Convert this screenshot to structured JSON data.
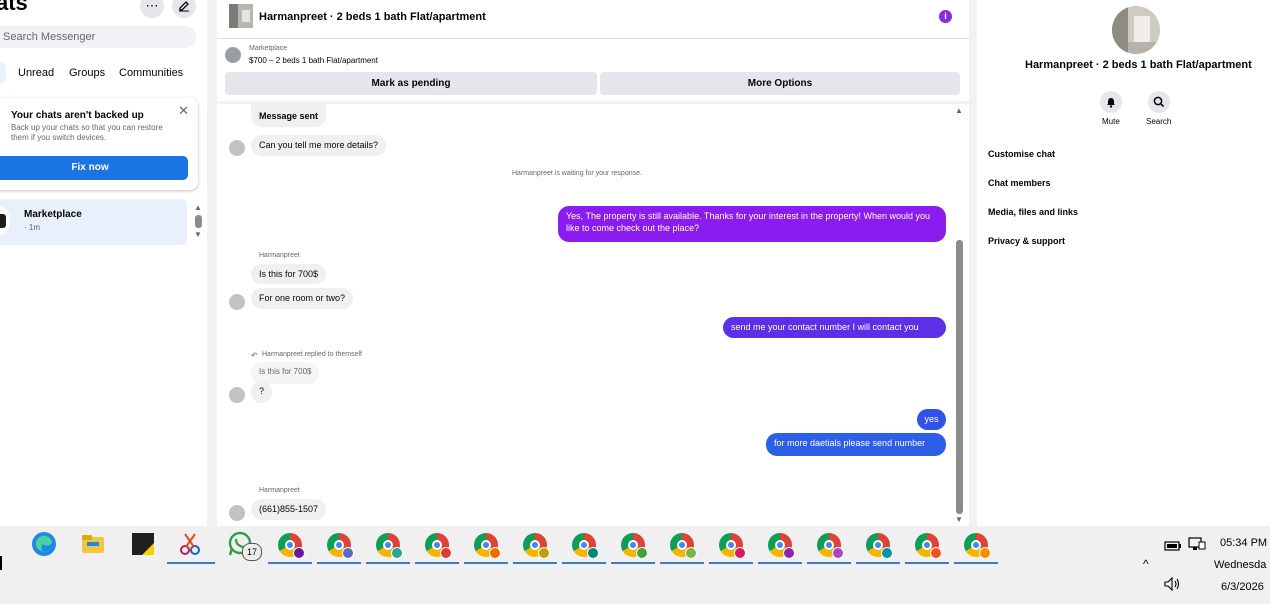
{
  "sidebar": {
    "title": "ats",
    "more_icon": "more-dots-icon",
    "compose_icon": "compose-icon",
    "search_placeholder": "Search Messenger",
    "filters": [
      "Unread",
      "Groups",
      "Communities"
    ],
    "backup_banner": {
      "title": "Your chats aren't backed up",
      "subtitle": "Back up your chats so that you can restore them if you switch devices.",
      "button": "Fix now"
    },
    "chat_item": {
      "name": "Marketplace",
      "time": "· 1m"
    }
  },
  "header": {
    "title": "Harmanpreet · 2 beds 1 bath Flat/apartment",
    "info_icon": "i"
  },
  "marketplace_bar": {
    "label": "Marketplace",
    "listing": "$700 – 2 beds 1 bath Flat/apartment",
    "mark_pending": "Mark as pending",
    "more_options": "More Options"
  },
  "messages": {
    "m1": "Message sent",
    "m2": "Can you tell me more details?",
    "waiting": "Harmanpreet is waiting for your response.",
    "o1": "Yes, The property is still available. Thanks for your interest in the property! When would you like to come check out the place?",
    "sender1": "Harmanpreet",
    "m3": "Is this for 700$",
    "m4": "For one room or two?",
    "o2": "send me your contact number I will contact you",
    "reply_note": "Harmanpreet replied to themself",
    "quoted": "Is this for 700$",
    "m5": "?",
    "o3": "yes",
    "o4": "for more daetials please send number",
    "sender2": "Harmanpreet",
    "m6": "(661)855-1507"
  },
  "right_panel": {
    "name": "Harmanpreet · 2 beds 1 bath Flat/apartment",
    "mute_label": "Mute",
    "search_label": "Search",
    "menu": [
      "Customise chat",
      "Chat members",
      "Media, files and links",
      "Privacy & support"
    ]
  },
  "taskbar": {
    "whatsapp_badge": "17",
    "time": "05:34 PM",
    "day": "Wednesda",
    "date": "6/3/2026"
  },
  "colors": {
    "outgoing_purple": "#8a1cf0",
    "outgoing_indigo": "#5c30e8",
    "outgoing_blue": "#2c5ee8",
    "fix_button": "#1b74e4"
  }
}
